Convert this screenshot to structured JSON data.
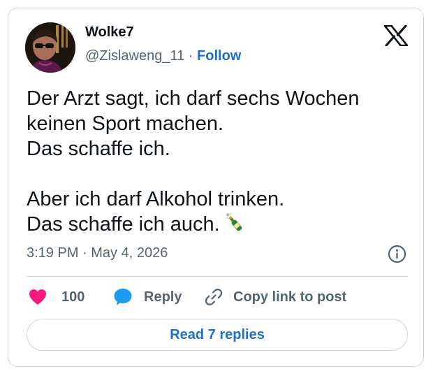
{
  "author": {
    "display_name": "Wolke7",
    "handle": "@Zislaweng_11",
    "separator": " · ",
    "follow_label": "Follow",
    "avatar_icon": "profile-photo"
  },
  "brand": {
    "logo_icon": "x-logo"
  },
  "tweet": {
    "lines": [
      "Der Arzt sagt, ich darf sechs Wochen",
      "keinen Sport machen.",
      "Das schaffe ich.",
      "",
      "Aber ich darf Alkohol trinken.",
      "Das schaffe ich auch."
    ],
    "emoji_icon": "bottle-with-popping-cork-icon",
    "timestamp": "3:19 PM · May 4, 2026",
    "info_icon": "info-icon"
  },
  "actions": {
    "likes_count": "100",
    "reply_label": "Reply",
    "copy_label": "Copy link to post",
    "read_replies_label": "Read 7 replies"
  },
  "colors": {
    "like": "#f91880",
    "reply": "#1d9bf0",
    "link": "#1d6fc7",
    "secondary_text": "#536471",
    "border": "#cfd9de"
  }
}
